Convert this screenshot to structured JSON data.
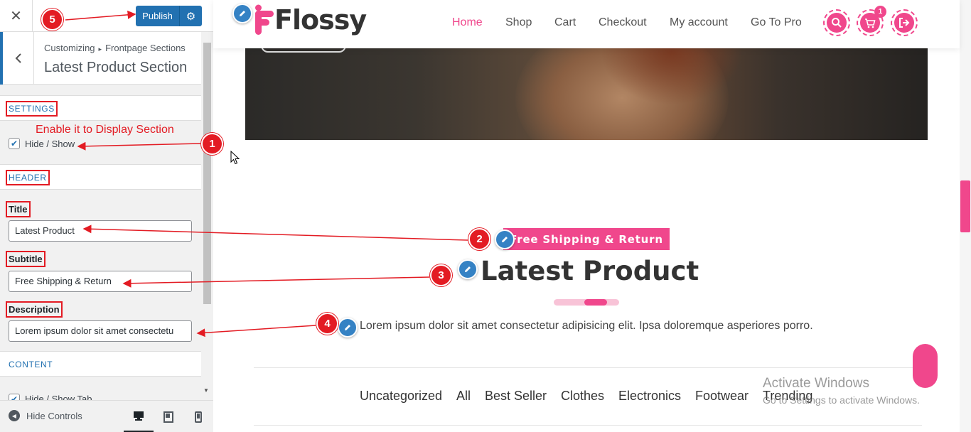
{
  "customizer": {
    "close_glyph": "✕",
    "publish_label": "Publish",
    "breadcrumb": {
      "root": "Customizing",
      "separator": "▸",
      "parent": "Frontpage Sections"
    },
    "section_title": "Latest Product Section",
    "groups": {
      "settings": "SETTINGS",
      "header": "HEADER",
      "content": "CONTENT"
    },
    "hide_show_label": "Hide / Show",
    "hide_show_checked": true,
    "hide_show_tab_label": "Hide / Show Tab",
    "fields": {
      "title": {
        "label": "Title",
        "value": "Latest Product"
      },
      "subtitle": {
        "label": "Subtitle",
        "value": "Free Shipping & Return"
      },
      "description": {
        "label": "Description",
        "value": "Lorem ipsum dolor sit amet consectetu"
      }
    },
    "footer": {
      "hide_controls": "Hide Controls"
    },
    "icons": {
      "settings": "gear-icon",
      "back": "chevron-left-icon",
      "desktop": "desktop-icon",
      "tablet": "tablet-icon",
      "mobile": "mobile-icon",
      "hide": "arrow-left-circle-icon"
    }
  },
  "site": {
    "brand": "Flossy",
    "nav": [
      "Home",
      "Shop",
      "Cart",
      "Checkout",
      "My account",
      "Go To Pro"
    ],
    "active_nav": "Home",
    "cart_count": "1",
    "accent_color": "#f0478c"
  },
  "latest_section": {
    "subtitle": "Free Shipping & Return",
    "title": "Latest Product",
    "description": "Lorem ipsum dolor sit amet consectetur adipisicing elit. Ipsa doloremque asperiores porro.",
    "tabs": [
      "Uncategorized",
      "All",
      "Best Seller",
      "Clothes",
      "Electronics",
      "Footwear",
      "Trending"
    ]
  },
  "watermark": {
    "line1": "Activate Windows",
    "line2": "Go to Settings to activate Windows."
  },
  "annotations": {
    "note": "Enable it to Display Section",
    "badges": [
      "1",
      "2",
      "3",
      "4",
      "5"
    ],
    "color": "#e31b23"
  }
}
